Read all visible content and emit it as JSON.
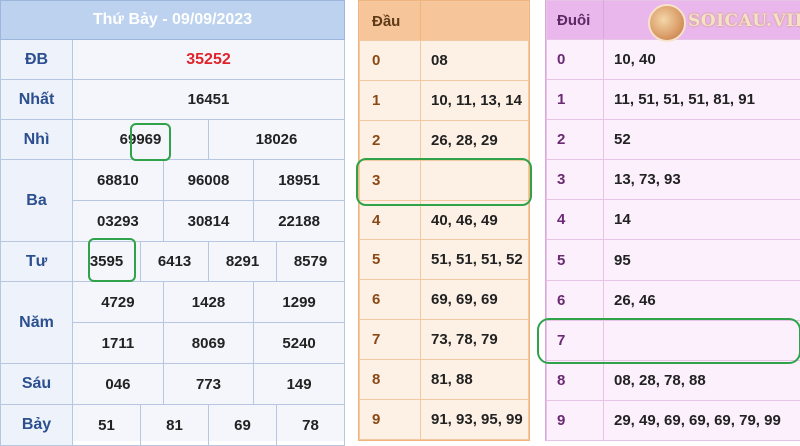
{
  "results": {
    "title": "Thứ Bảy - 09/09/2023",
    "special": {
      "label": "ĐB",
      "value": "35252"
    },
    "first": {
      "label": "Nhất",
      "value": "16451"
    },
    "second": {
      "label": "Nhì",
      "values": [
        "69969",
        "18026"
      ]
    },
    "third": {
      "label": "Ba",
      "values": [
        "68810",
        "96008",
        "18951",
        "03293",
        "30814",
        "22188"
      ]
    },
    "fourth": {
      "label": "Tư",
      "values": [
        "3595",
        "6413",
        "8291",
        "8579"
      ]
    },
    "fifth": {
      "label": "Năm",
      "values": [
        "4729",
        "1428",
        "1299",
        "1711",
        "8069",
        "5240"
      ]
    },
    "sixth": {
      "label": "Sáu",
      "values": [
        "046",
        "773",
        "149"
      ]
    },
    "seventh": {
      "label": "Bảy",
      "values": [
        "51",
        "81",
        "69",
        "78"
      ]
    }
  },
  "dau": {
    "header": "Đầu",
    "rows": [
      {
        "k": "0",
        "v": "08"
      },
      {
        "k": "1",
        "v": "10, 11, 13, 14"
      },
      {
        "k": "2",
        "v": "26, 28, 29"
      },
      {
        "k": "3",
        "v": ""
      },
      {
        "k": "4",
        "v": "40, 46, 49"
      },
      {
        "k": "5",
        "v": "51, 51, 51, 52"
      },
      {
        "k": "6",
        "v": "69, 69, 69"
      },
      {
        "k": "7",
        "v": "73, 78, 79"
      },
      {
        "k": "8",
        "v": "81, 88"
      },
      {
        "k": "9",
        "v": "91, 93, 95, 99"
      }
    ]
  },
  "duoi": {
    "header": "Đuôi",
    "rows": [
      {
        "k": "0",
        "v": "10, 40"
      },
      {
        "k": "1",
        "v": "11, 51, 51, 51, 81, 91"
      },
      {
        "k": "2",
        "v": "52"
      },
      {
        "k": "3",
        "v": "13, 73, 93"
      },
      {
        "k": "4",
        "v": "14"
      },
      {
        "k": "5",
        "v": "95"
      },
      {
        "k": "6",
        "v": "26, 46"
      },
      {
        "k": "7",
        "v": ""
      },
      {
        "k": "8",
        "v": "08, 28, 78, 88"
      },
      {
        "k": "9",
        "v": "29, 49, 69, 69, 69, 79, 99"
      }
    ]
  },
  "logo": {
    "text": "SOICAU.VIP"
  },
  "colors": {
    "header_blue": "#bcd2ef",
    "header_orange": "#f6c59a",
    "header_pink": "#eab7ec",
    "special_red": "#e0232b",
    "highlight_green": "#2fa24a"
  }
}
